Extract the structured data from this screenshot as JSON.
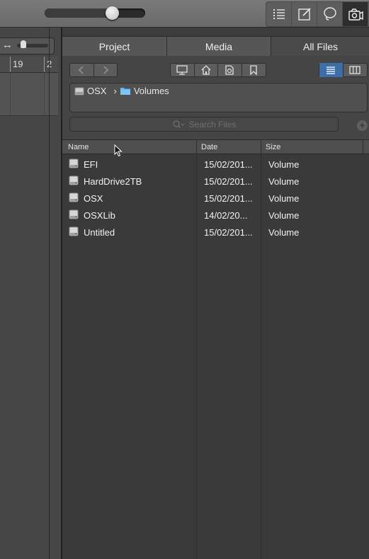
{
  "toolbar": {
    "zoom_level": 0.68,
    "icons": [
      "list-view-icon",
      "notes-edit-icon",
      "loops-lasso-icon",
      "media-browser-icon"
    ]
  },
  "timeline": {
    "ruler_numbers": [
      "19",
      "2"
    ],
    "scroll_icon": "horizontal-resize-icon"
  },
  "browser": {
    "tabs": [
      {
        "label": "Project",
        "selected": false
      },
      {
        "label": "Media",
        "selected": false
      },
      {
        "label": "All Files",
        "selected": true
      }
    ],
    "path": {
      "root": "OSX",
      "separator": "›",
      "folder": "Volumes"
    },
    "search": {
      "placeholder": "Search Files"
    },
    "columns": {
      "name": "Name",
      "date": "Date",
      "size": "Size"
    },
    "files": [
      {
        "name": "EFI",
        "date": "15/02/201...",
        "size": "Volume"
      },
      {
        "name": "HardDrive2TB",
        "date": "15/02/201...",
        "size": "Volume"
      },
      {
        "name": "OSX",
        "date": "15/02/201...",
        "size": "Volume"
      },
      {
        "name": "OSXLib",
        "date": "14/02/20...",
        "size": "Volume"
      },
      {
        "name": "Untitled",
        "date": "15/02/201...",
        "size": "Volume"
      }
    ]
  },
  "colors": {
    "accent": "#3d6ea8",
    "folder": "#5fb4f0"
  }
}
